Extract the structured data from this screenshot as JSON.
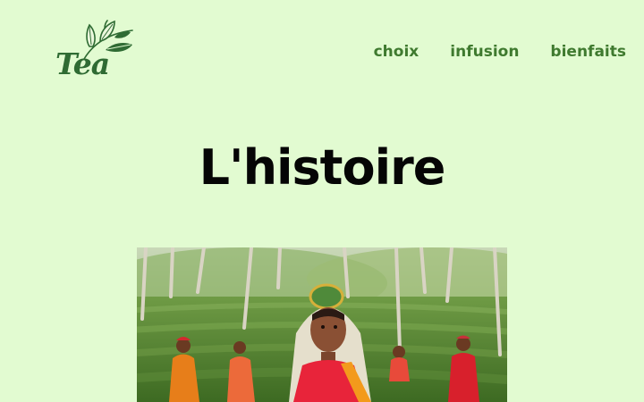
{
  "logo": {
    "text": "Tea",
    "icon": "tea-leaves-icon",
    "color": "#2f6b33"
  },
  "nav": {
    "items": [
      {
        "label": "choix"
      },
      {
        "label": "infusion"
      },
      {
        "label": "bienfaits"
      }
    ],
    "color": "#3f7a2f"
  },
  "main": {
    "title": "L'histoire"
  },
  "colors": {
    "background": "#e2fbd1",
    "title": "#050505"
  }
}
